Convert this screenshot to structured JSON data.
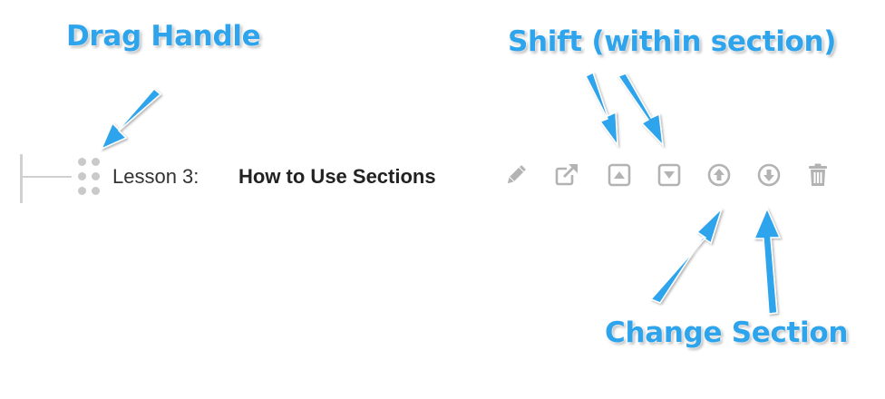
{
  "annotations": {
    "drag_handle": "Drag Handle",
    "shift": "Shift (within section)",
    "change_section": "Change Section"
  },
  "lesson": {
    "prefix": "Lesson 3:",
    "title": "How to Use Sections"
  },
  "actions": [
    {
      "icon": "pencil-icon",
      "label": "edit"
    },
    {
      "icon": "external-link-icon",
      "label": "open"
    },
    {
      "icon": "caret-up-square-icon",
      "label": "shift up within section"
    },
    {
      "icon": "caret-down-square-icon",
      "label": "shift down within section"
    },
    {
      "icon": "arrow-circle-up-icon",
      "label": "move to previous section"
    },
    {
      "icon": "arrow-circle-down-icon",
      "label": "move to next section"
    },
    {
      "icon": "trash-icon",
      "label": "delete"
    }
  ],
  "colors": {
    "annotation": "#2ea4ec",
    "icon": "#b3b3b3",
    "tree_line": "#d0d0d0"
  }
}
